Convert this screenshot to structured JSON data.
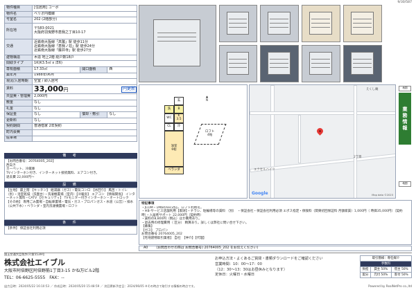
{
  "page_id": "9/30/587",
  "table": [
    {
      "k": "物件種目",
      "v": "[住居用] コーポ"
    },
    {
      "k": "物件名",
      "v": "ベリオ円模蝶"
    },
    {
      "k": "号室名",
      "v": "202 (2階部分)"
    },
    {
      "k": "所在地",
      "v": "〒583-0021\n大阪府羽曳野市恵我之丁目10-17"
    },
    {
      "k": "交通",
      "v": "近鉄南大阪線「高鷲」駅 徒歩11分\n近鉄南大阪線「恵我ノ荘」駅 徒歩24分\n近鉄南大阪線「藤井寺」駅 徒歩27分"
    },
    {
      "k": "建物構造",
      "v": "木造 地上2階 総戸数18戸"
    },
    {
      "k": "間取タイプ",
      "v": "1K(K3.5㎡ x 洋6)"
    },
    {
      "k": "専有面積",
      "v": "17.33㎡",
      "k2": "開口面積",
      "v2": "西"
    },
    {
      "k": "築年月",
      "v": "1988年06月"
    },
    {
      "k": "現況/入居時期",
      "v": "空室 / 即入居可"
    }
  ],
  "rent": {
    "label": "賃料",
    "amount": "33,000",
    "unit": "円",
    "badge": "円更新"
  },
  "fees": [
    {
      "k": "共益費・管理費",
      "v": "2,000円"
    },
    {
      "k": "敷金",
      "v": "なし"
    },
    {
      "k": "礼金",
      "v": "なし"
    },
    {
      "k": "保証金",
      "v": "なし",
      "k2": "償却・敷引",
      "v2": "なし"
    },
    {
      "k": "更新料",
      "v": "なし"
    },
    {
      "k": "契約期間",
      "v": "普通借家 2年契約"
    },
    {
      "k": "町内会費",
      "v": ""
    },
    {
      "k": "駐車場",
      "v": ""
    }
  ],
  "remarks": {
    "title": "備 考",
    "body": "【お問合番号：20764005_202】\n西向き\nカーペット、冷蔵庫\nTVインターホン付き、インターネット接続無料、エアコン付き。\n退去費 22,000円〜"
  },
  "equipment": {
    "title": "設 備",
    "body": "【立地】 最上階 【キッチン】 給湯器（ガス）・電気コンロ 【水回り】 風呂・トイレ（別）・浴室乾燥（洗面台）・洗濯機置場（室内）【冷暖房】 エアコン 【情報関係】 インターネット無料・CATV 【セキュリティ】 TVモニター付きインターホン・オートロック 【その他】 専用ごみ置場・自転車置場・電気・ガス・プロパンガス・水道（公営）・排水（公共下水）・ベランダ・室内洗濯機置場・ロフト"
  },
  "conditions": {
    "title": "条 件",
    "body": "【条件】 保証会社利用必須"
  },
  "plan": {
    "rooms": {
      "wash": "洗",
      "bath": "B",
      "toilet": "WC",
      "kitchen": "K\n3.5",
      "closet": "CL",
      "genkan": "玄",
      "room": "洋室\n6帖",
      "balcony": "ベランダ",
      "loft": "ロフト\n4帖",
      "fridge": "冷"
    },
    "compass": "N"
  },
  "map": {
    "labels": [
      "エクセルハイツ",
      "2丁目",
      "えくし庵"
    ],
    "google": "Google",
    "mapdata": "Map data ©2023"
  },
  "side": {
    "tab": "業務情報",
    "btns": [
      "地図",
      "地図"
    ]
  },
  "notes": "※この資料は情報提供のみを目的としております。当ものは、写真、間取図面、地図等、掲載内容は現況を優先します。万が一、現況と異なる場合は、現況を優先します。掲載情報に誤りや変更が生じた場合は、広告主までお問い合わせ下さい。",
  "info": {
    "title": "特記事項",
    "lines": [
      "・JCOM・1Mbit/sec対応、ロフト利用可。",
      "・※B-サービス店舗利用【家財】・チラシ、駐輪場等の賃料 （別）　・保証会社・保証会社利用必須 エポス指定・保険料（関東初回保証料 月額家賃）1,000円（ 時価35,000円）（契約時）・入居者サポート 22,000円（契約時）",
      "・賃料の8,800円（税込）ほか費用あり。",
      "・退去時の修理費用（ 区分） 精算あり。詳しくは弊社に問い合せ下さい。",
      "【募集】",
      "【ガス】 プロパン",
      "お問合番号 20764005_202",
      "【宅地建物取引業者】 自社　【仲介】【代理】"
    ]
  },
  "strip": [
    "A0",
    "(お問合わせの際は お問合番号) 20764005_202 をお伝えください)"
  ],
  "agent": {
    "license": "国土交通大臣免許(7)第5539号",
    "name": "株式会社エイブル",
    "address": "大阪市阿倍野区阿倍野筋1丁目3-15 かね万ビル2階",
    "tel": "TEL：06-6625-5555　FAX：--"
  },
  "contact": [
    "お申込方法・よくあるご質問・書類ダウンロードをご確認ください",
    "営業時間：10：00〜17：00",
    "（12：30〜13：30はお昼休みとなります）",
    "定休日：火曜日・水曜日"
  ],
  "fee_table": {
    "title": "取引態様：専任媒介",
    "header": "手数料",
    "rows": [
      [
        "負担",
        "貸主 50%",
        "借主 50%"
      ],
      [
        "配分",
        "元付 50%",
        "客付 50%"
      ]
    ]
  },
  "bottom": {
    "left": "出力日時：2024/05/22 16:10:53 ／ 作成日時：2024/05/20 15:48:59 ／ 次回更新予定日：2024/06/05 ※その時点で取引する情報の時点です。",
    "right": "Powered by RealNetPro co.,ltd"
  }
}
